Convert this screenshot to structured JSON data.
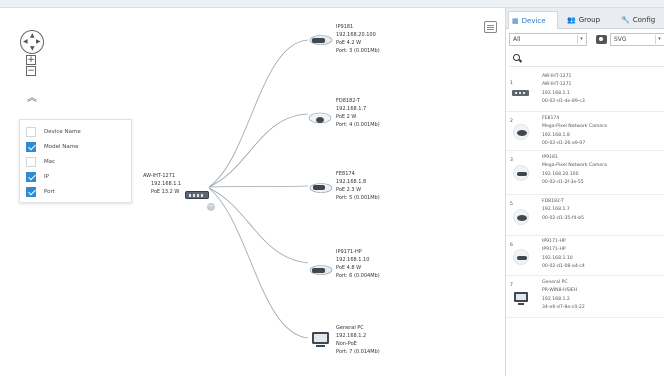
{
  "filter": {
    "items": [
      {
        "label": "Device Name",
        "checked": false
      },
      {
        "label": "Model Name",
        "checked": true
      },
      {
        "label": "Mac",
        "checked": false
      },
      {
        "label": "IP",
        "checked": true
      },
      {
        "label": "Port",
        "checked": true
      }
    ]
  },
  "topology": {
    "root": {
      "lines": [
        "AW-IHT-1271",
        "192.168.1.1",
        "PoE 13.2 W"
      ]
    },
    "nodes": [
      {
        "icon": "bullet-camera-icon",
        "lines": [
          "IP9181",
          "192.168.20.100",
          "PoE 4.2 W",
          "Port: 3 (0.001Mb)"
        ]
      },
      {
        "icon": "dome-camera-icon",
        "lines": [
          "FD8182-T",
          "192.168.1.7",
          "PoE 2 W",
          "Port: 4 (0.001Mb)"
        ]
      },
      {
        "icon": "box-camera-icon",
        "lines": [
          "FE8174",
          "192.168.1.8",
          "PoE 2.3 W",
          "Port: 5 (0.001Mb)"
        ]
      },
      {
        "icon": "bullet-camera-icon",
        "lines": [
          "IP9171-HP",
          "192.168.1.10",
          "PoE 4.8 W",
          "Port: 6 (0.004Mb)"
        ]
      },
      {
        "icon": "pc-monitor-icon",
        "lines": [
          "General PC",
          "192.168.1.2",
          "Non-PoE",
          "Port: 7 (0.014Mb)"
        ]
      }
    ]
  },
  "panel": {
    "tabs": [
      {
        "label": "Device",
        "icon": "grid-icon",
        "active": true
      },
      {
        "label": "Group",
        "icon": "users-icon",
        "active": false
      },
      {
        "label": "Config",
        "icon": "wrench-icon",
        "active": false
      }
    ],
    "filter_select": "All",
    "export_select": "SVG",
    "devices": [
      {
        "index": "1",
        "icon": "switch-icon",
        "lines": [
          "AW-IHT-1271",
          "AW-IHT-1271",
          "192.168.1.1",
          "00-02-d1-de-89-c3"
        ]
      },
      {
        "index": "2",
        "icon": "dome-camera-icon",
        "lines": [
          "FE8174",
          "Mega-Pixel Network Camera",
          "192.168.1.8",
          "00-02-d1-26-a9-07"
        ]
      },
      {
        "index": "3",
        "icon": "bullet-camera-icon",
        "lines": [
          "IP9181",
          "Mega-Pixel Network Camera",
          "192.168.20.100",
          "00-02-d1-2f-3e-55"
        ]
      },
      {
        "index": "5",
        "icon": "dome-camera-icon",
        "lines": [
          "FD8182-T",
          "",
          "192.168.1.7",
          "00-02-d1-35-f4-b5"
        ]
      },
      {
        "index": "6",
        "icon": "bullet-camera-icon",
        "lines": [
          "IP9171-HP",
          "IP9171-HP",
          "192.168.1.10",
          "00-02-d1-08-a4-c4"
        ]
      },
      {
        "index": "7",
        "icon": "pc-monitor-icon",
        "lines": [
          "General PC",
          "PR-WIN8-HSIEH",
          "192.168.1.2",
          "34-e6-d7-8e-c0-22"
        ]
      }
    ]
  },
  "colors": {
    "accent": "#2d8cd2",
    "link": "#2d78c3",
    "border": "#cfd6dc"
  }
}
